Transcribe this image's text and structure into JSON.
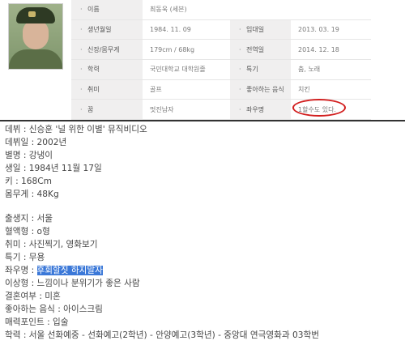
{
  "profile": {
    "rows": [
      {
        "label1": "이름",
        "value1": "최동욱 (세븐)",
        "label2": "",
        "value2": ""
      },
      {
        "label1": "생년월일",
        "value1": "1984. 11. 09",
        "label2": "입대일",
        "value2": "2013. 03. 19"
      },
      {
        "label1": "신장/몸무게",
        "value1": "179cm / 68kg",
        "label2": "전역일",
        "value2": "2014. 12. 18"
      },
      {
        "label1": "학력",
        "value1": "국민대학교 대학원졸",
        "label2": "특기",
        "value2": "춤, 노래"
      },
      {
        "label1": "취미",
        "value1": "골프",
        "label2": "좋아하는 음식",
        "value2": "치킨"
      },
      {
        "label1": "꿈",
        "value1": "멋진남자",
        "label2": "좌우명",
        "value2": "1할수도 있다."
      }
    ]
  },
  "info": {
    "group1": [
      "데뷔 : 신승훈 '널 위한 이별' 뮤직비디오",
      "데뷔일 : 2002년",
      "별명 : 강냉이",
      "생일 : 1984년 11월 17일",
      "키 : 168Cm",
      "몸무게 : 48Kg"
    ],
    "group2_before": [
      "출생지 : 서울",
      "혈액형 : o형",
      "취미 : 사진찍기, 영화보기",
      "특기 : 무용"
    ],
    "motto_label": "좌우명 : ",
    "motto_value": "후회할짓 하지말자",
    "group2_after": [
      "이상형 : 느낌이나 분위기가 좋은 사람",
      "결혼여부 : 미혼",
      "좋아하는 음식 : 아이스크림",
      "매력포인트 : 입술",
      "학력 : 서울 선화예중 - 선화예고(2학년) - 안양예고(3학년) - 중앙대 연극영화과 03학번"
    ]
  },
  "colors": {
    "highlight": "#3b78d8",
    "circle": "#d21f1f",
    "label_bg": "#f0efef"
  }
}
